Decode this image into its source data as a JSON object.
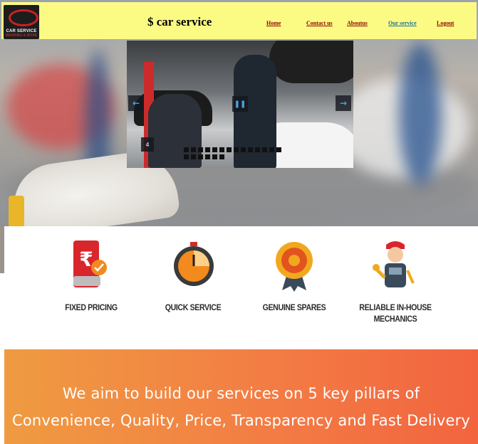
{
  "header": {
    "logo_text": "CAR SERVICE",
    "logo_subtext": "WASHING & MORE",
    "brand": "$ car service"
  },
  "nav": {
    "home": "Home",
    "contact": "Contact us",
    "about": "Aboutus",
    "service": "Our service",
    "logout": "Logout"
  },
  "slider": {
    "counter": "4",
    "prev_icon": "arrow-left-icon",
    "next_icon": "arrow-right-icon",
    "pause_icon": "pause-icon"
  },
  "features": [
    {
      "label": "FIXED PRICING",
      "icon": "rupee-receipt-icon"
    },
    {
      "label": "QUICK SERVICE",
      "icon": "stopwatch-icon"
    },
    {
      "label": "GENUINE SPARES",
      "icon": "gear-badge-icon"
    },
    {
      "label": "RELIABLE IN-HOUSE MECHANICS",
      "icon": "mechanic-icon"
    }
  ],
  "banner": {
    "line1": "We aim to build our services on 5 key pillars of",
    "line2": "Convenience, Quality, Price, Transparency and Fast Delivery"
  },
  "colors": {
    "header_bg": "#fbfb84",
    "nav_link": "#8b0000",
    "nav_active": "#1a6e9e",
    "banner_start": "#ef9b42",
    "banner_end": "#f2643f",
    "icon_orange": "#f28a1e",
    "icon_red": "#d9262c"
  }
}
